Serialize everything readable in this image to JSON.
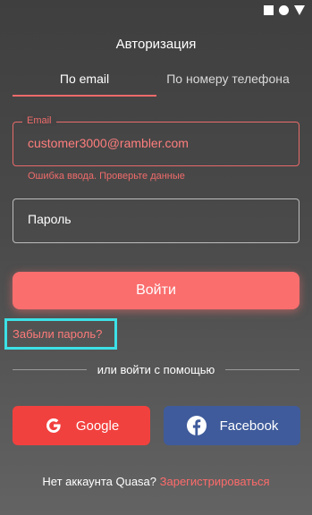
{
  "status_icons": [
    "square-icon",
    "circle-icon",
    "triangle-icon"
  ],
  "header": {
    "title": "Авторизация"
  },
  "tabs": [
    {
      "label": "По email",
      "active": true
    },
    {
      "label": "По номеру телефона",
      "active": false
    }
  ],
  "email_field": {
    "label": "Email",
    "value": "customer3000@rambler.com",
    "error": "Ошибка ввода. Проверьте данные"
  },
  "password_field": {
    "placeholder": "Пароль",
    "value": ""
  },
  "login_button": {
    "label": "Войти"
  },
  "forgot_password": {
    "label": "Забыли пароль?"
  },
  "divider": {
    "label": "или войти с помощью"
  },
  "social": {
    "google": {
      "label": "Google",
      "icon": "google-icon"
    },
    "facebook": {
      "label": "Facebook",
      "icon": "facebook-icon"
    }
  },
  "signup": {
    "question": "Нет аккаунта Quasa?",
    "link": "Зарегистрироваться"
  },
  "colors": {
    "accent": "#fa6e6e",
    "error": "#f06b6b",
    "google": "#f1413e",
    "facebook": "#3f5b9b",
    "highlight": "#3ce1e6"
  }
}
